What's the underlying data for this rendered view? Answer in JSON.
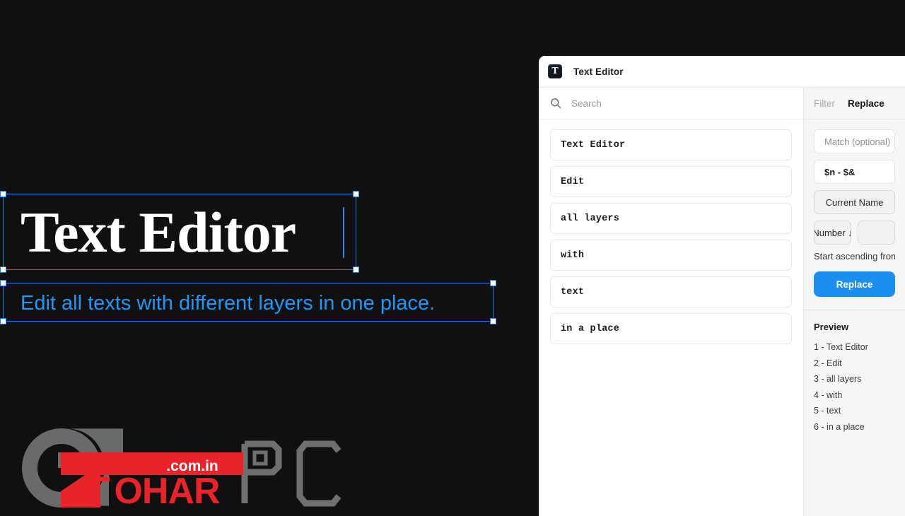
{
  "canvas": {
    "background_color": "#101010",
    "layers": [
      {
        "id": "headline",
        "text": "Text Editor",
        "color": "#ffffff",
        "selected": true,
        "has_caret": true
      },
      {
        "id": "subtitle",
        "text": "Edit all texts with different layers in one place.",
        "color": "#2196f3",
        "selected": true,
        "has_caret": false
      }
    ],
    "selection_color": "#1a7fe0"
  },
  "watermark": {
    "g_letter": "G",
    "word": "TOHAR",
    "domain": ".com.in",
    "suffix": "PC",
    "red": "#e8232a",
    "grey": "#6a6a6a"
  },
  "window": {
    "titlebar": {
      "app_icon_glyph": "T",
      "title": "Text Editor"
    },
    "search": {
      "icon": "search-icon",
      "placeholder": "Search"
    },
    "layers": [
      {
        "text": "Text Editor"
      },
      {
        "text": "Edit"
      },
      {
        "text": "all layers"
      },
      {
        "text": "with"
      },
      {
        "text": "text"
      },
      {
        "text": "in a place"
      }
    ],
    "options": {
      "tabs": [
        {
          "label": "Filter",
          "active": false
        },
        {
          "label": "Replace",
          "active": true
        }
      ],
      "match_field": {
        "placeholder": "Match (optional)",
        "value": ""
      },
      "replace_field": {
        "value": "$n - $&"
      },
      "name_source_button": "Current Name",
      "sort_button": "Number ↓",
      "second_sort_button": "",
      "ascending_hint": "Start ascending from",
      "apply_button": "Replace",
      "accent_color": "#1c8ef0"
    },
    "preview": {
      "title": "Preview",
      "lines": [
        "1 - Text Editor",
        "2 - Edit",
        "3 - all layers",
        "4 - with",
        "5 - text",
        "6 - in a place"
      ]
    }
  }
}
